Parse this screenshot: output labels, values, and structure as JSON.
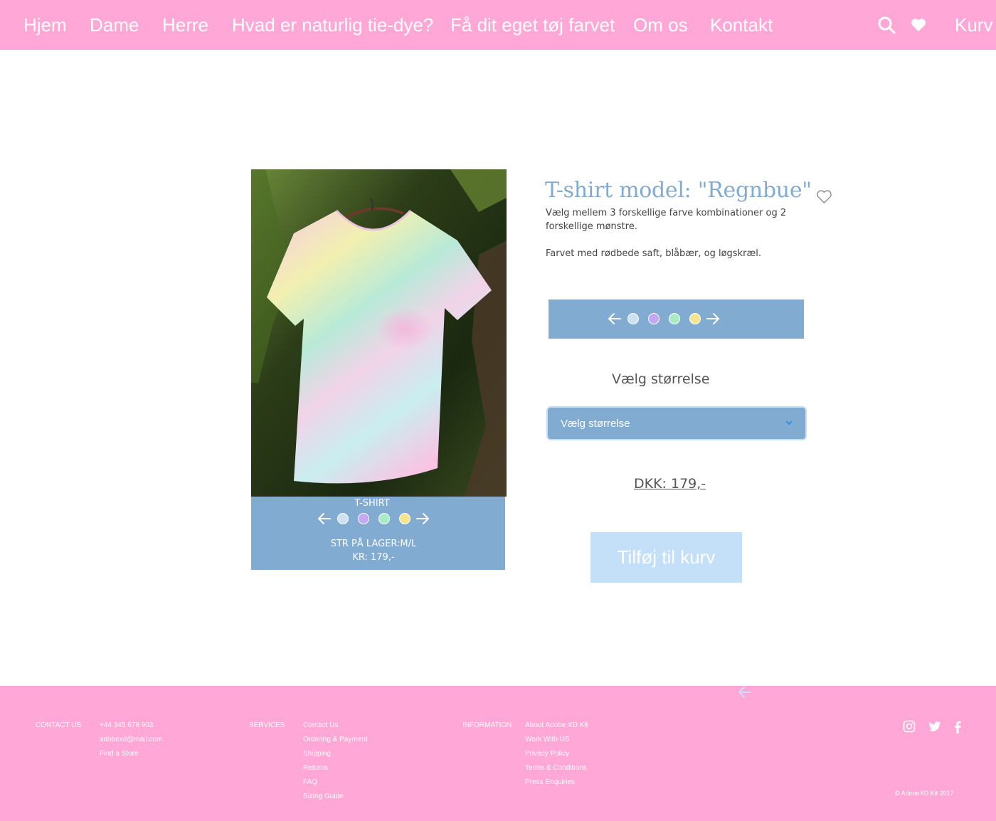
{
  "nav": {
    "items": [
      "Hjem",
      "Dame",
      "Herre",
      "Hvad er naturlig tie-dye?",
      "Få dit eget tøj farvet",
      "Om os",
      "Kontakt"
    ],
    "cart_label": "Kurv",
    "icons": [
      "search-icon",
      "heart-icon"
    ]
  },
  "product_card": {
    "category": "T-SHIRT",
    "stock": "STR PÅ LAGER:M/L",
    "price": "KR: 179,-"
  },
  "product": {
    "title": "T-shirt model: \"Regnbue\"",
    "description": "Vælg mellem 3 forskellige farve kombinationer og 2 forskellige mønstre.",
    "dye_note": "Farvet med rødbede saft, blåbær, og løgskræl.",
    "size_label": "Vælg størrelse",
    "size_select": {
      "selected": "Vælg størrelse"
    },
    "price": "DKK: 179,-",
    "add_to_cart": "Tilføj til kurv"
  },
  "color_swatches": [
    "#cfe0f3",
    "#c6a7f5",
    "#a9ecc4",
    "#f5e58f"
  ],
  "colors": {
    "pink": "#ffa7d6",
    "blue": "#82abd1",
    "light_blue": "#c4e0f8",
    "title_blue": "#82abd1"
  },
  "footer": {
    "contact": {
      "heading": "CONTACT US",
      "phone": "+44 345 678 903",
      "email": "adobexd@mail.com",
      "store": "Find a Store"
    },
    "services": {
      "heading": "SERVICES",
      "links": [
        "Contact Us",
        "Ordering & Payment",
        "Shipping",
        "Returns",
        "FAQ",
        "Sizing Guide"
      ]
    },
    "information": {
      "heading": "INFORMATION",
      "links": [
        "About Adobe XD Kit",
        "Work With US",
        "Privacy Policy",
        "Terms & Conditions",
        "Press Enquiries"
      ]
    },
    "social_icons": [
      "instagram-icon",
      "twitter-icon",
      "facebook-icon"
    ],
    "copyright": "© AdobeXD Kit 2017"
  }
}
